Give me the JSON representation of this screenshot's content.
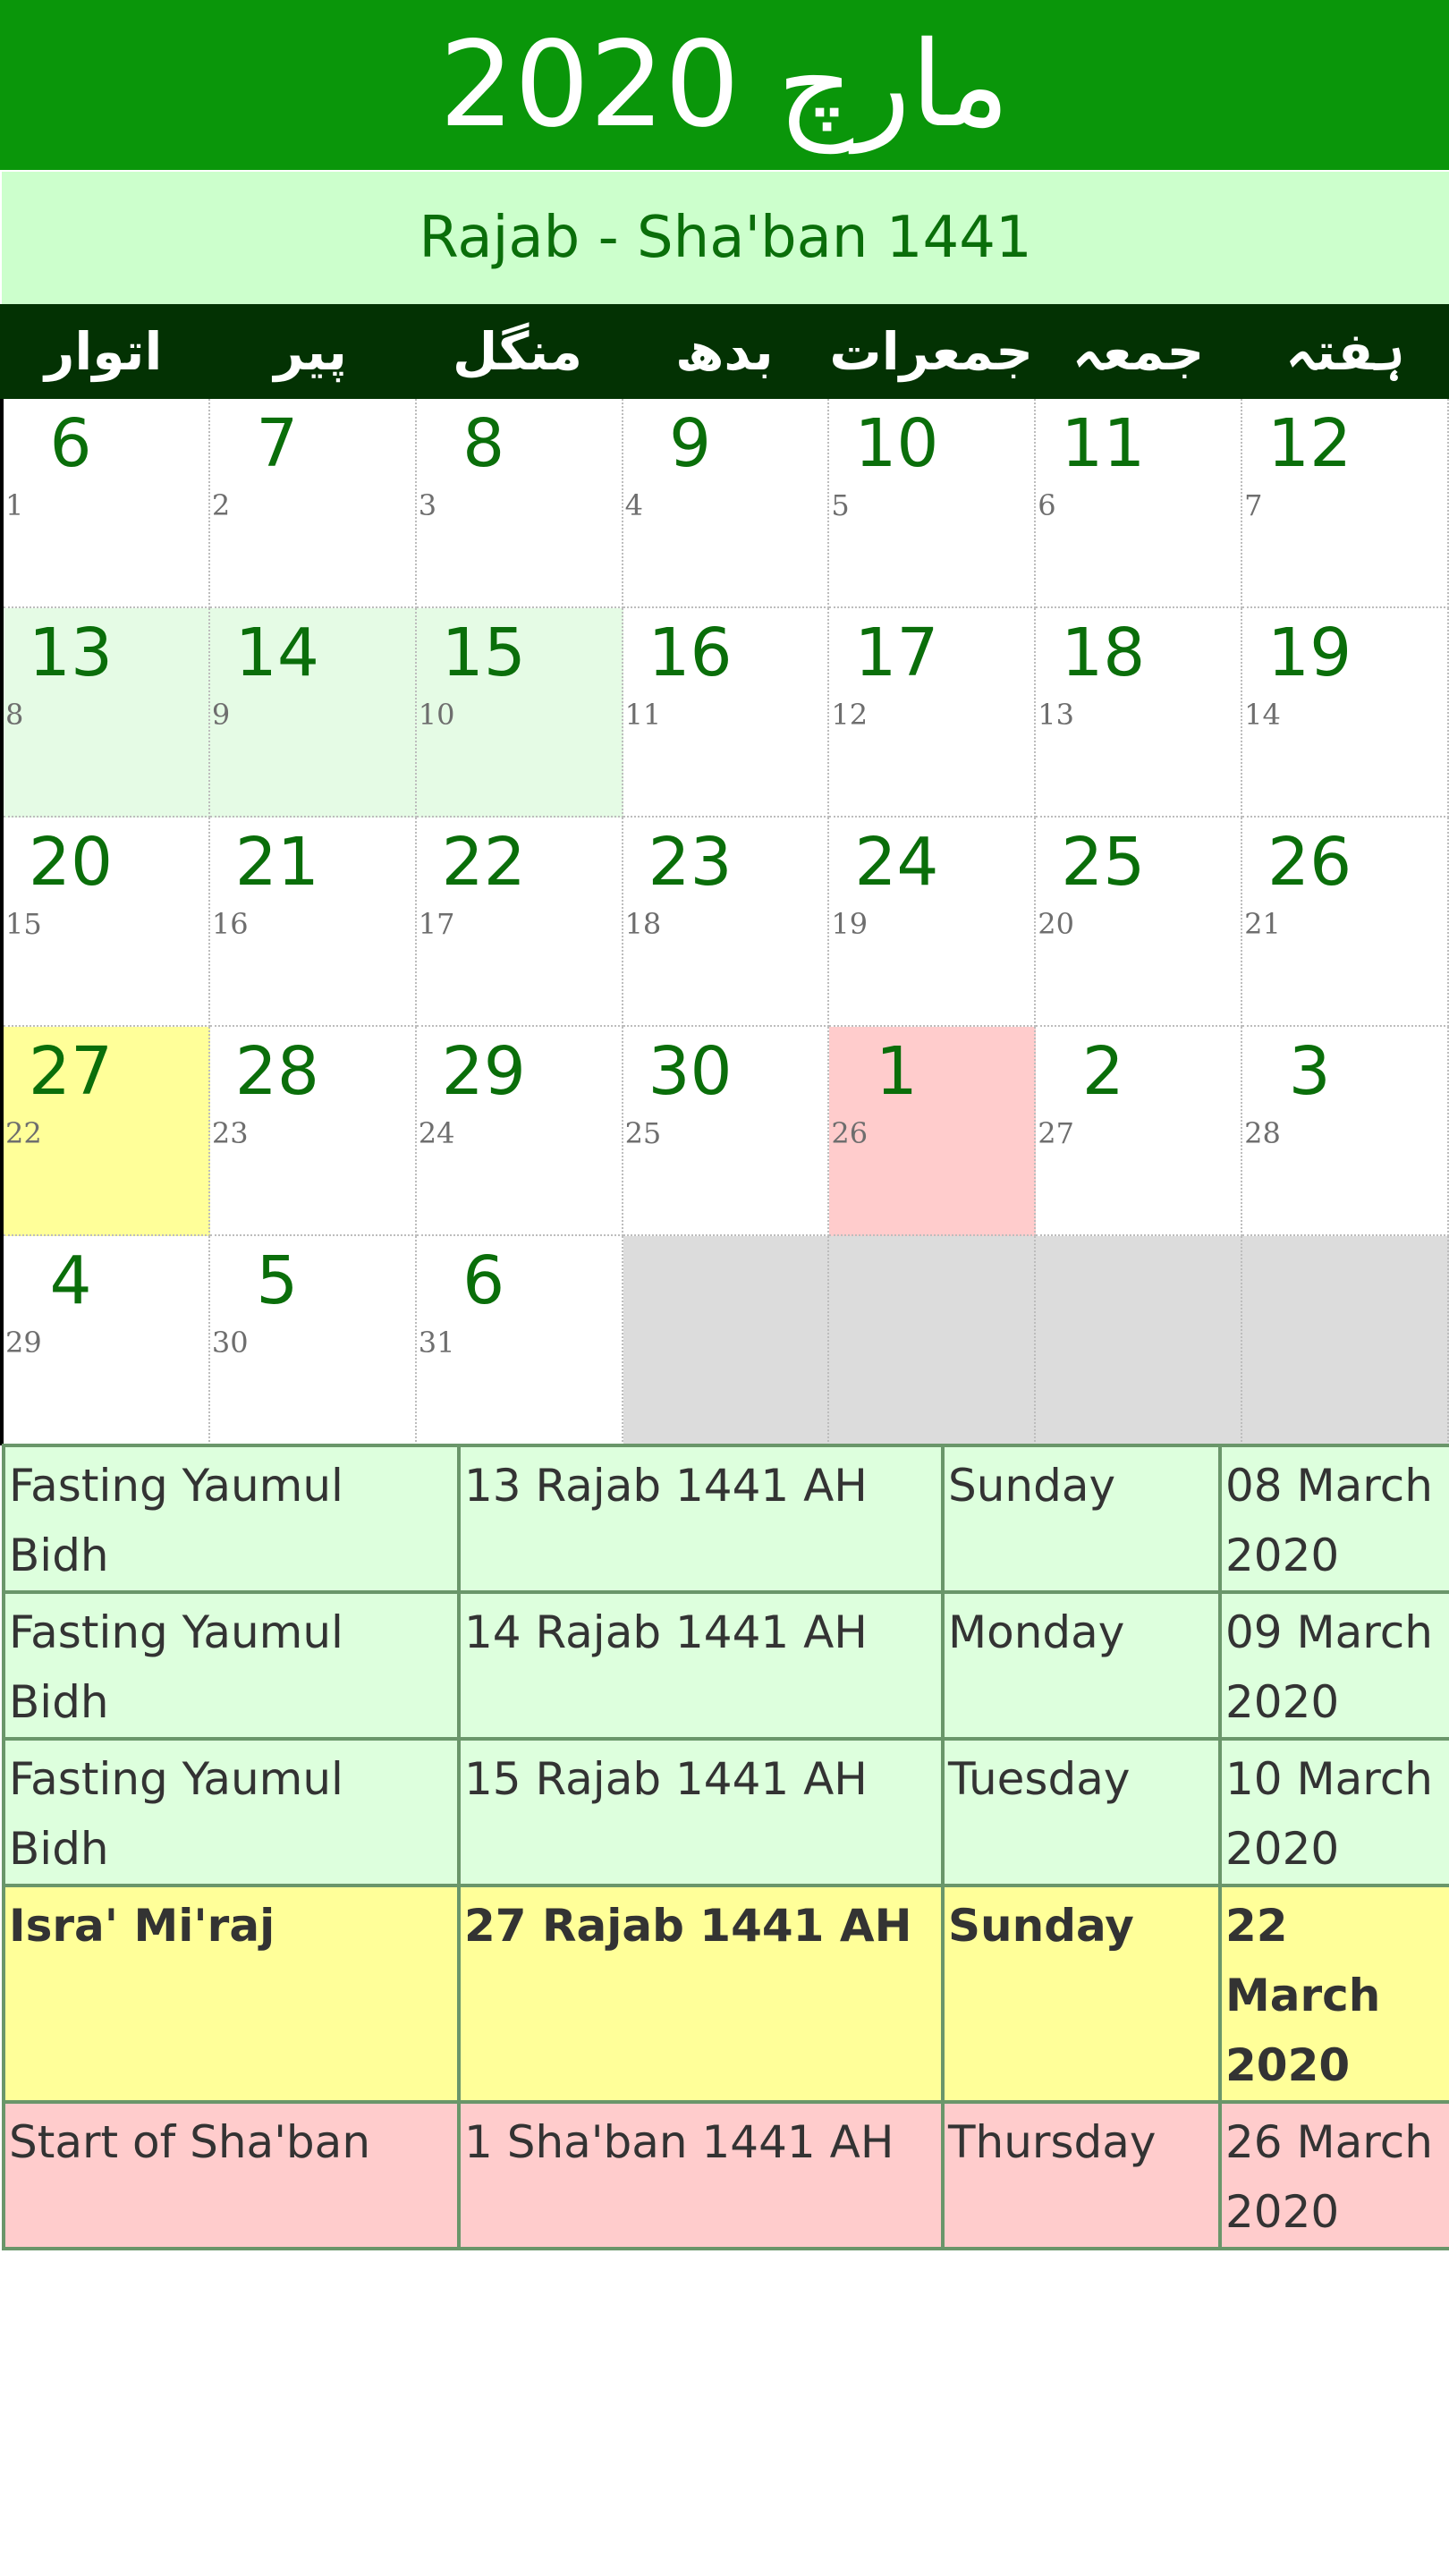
{
  "header": {
    "title": "مارچ 2020",
    "subtitle": "Rajab - Sha'ban 1441"
  },
  "weekdays": [
    "اتوار",
    "پیر",
    "منگل",
    "بدھ",
    "جمعرات",
    "جمعہ",
    "ہفتہ"
  ],
  "calendar": {
    "weeks": [
      [
        {
          "hijri": "6",
          "greg": "1",
          "style": "normal"
        },
        {
          "hijri": "7",
          "greg": "2",
          "style": "normal"
        },
        {
          "hijri": "8",
          "greg": "3",
          "style": "normal"
        },
        {
          "hijri": "9",
          "greg": "4",
          "style": "normal"
        },
        {
          "hijri": "10",
          "greg": "5",
          "style": "normal"
        },
        {
          "hijri": "11",
          "greg": "6",
          "style": "normal"
        },
        {
          "hijri": "12",
          "greg": "7",
          "style": "normal"
        }
      ],
      [
        {
          "hijri": "13",
          "greg": "8",
          "style": "light"
        },
        {
          "hijri": "14",
          "greg": "9",
          "style": "light"
        },
        {
          "hijri": "15",
          "greg": "10",
          "style": "light"
        },
        {
          "hijri": "16",
          "greg": "11",
          "style": "normal"
        },
        {
          "hijri": "17",
          "greg": "12",
          "style": "normal"
        },
        {
          "hijri": "18",
          "greg": "13",
          "style": "normal"
        },
        {
          "hijri": "19",
          "greg": "14",
          "style": "normal"
        }
      ],
      [
        {
          "hijri": "20",
          "greg": "15",
          "style": "normal"
        },
        {
          "hijri": "21",
          "greg": "16",
          "style": "normal"
        },
        {
          "hijri": "22",
          "greg": "17",
          "style": "normal"
        },
        {
          "hijri": "23",
          "greg": "18",
          "style": "normal"
        },
        {
          "hijri": "24",
          "greg": "19",
          "style": "normal"
        },
        {
          "hijri": "25",
          "greg": "20",
          "style": "normal"
        },
        {
          "hijri": "26",
          "greg": "21",
          "style": "normal"
        }
      ],
      [
        {
          "hijri": "27",
          "greg": "22",
          "style": "today"
        },
        {
          "hijri": "28",
          "greg": "23",
          "style": "normal"
        },
        {
          "hijri": "29",
          "greg": "24",
          "style": "normal"
        },
        {
          "hijri": "30",
          "greg": "25",
          "style": "normal"
        },
        {
          "hijri": "1",
          "greg": "26",
          "style": "pink"
        },
        {
          "hijri": "2",
          "greg": "27",
          "style": "normal"
        },
        {
          "hijri": "3",
          "greg": "28",
          "style": "normal"
        }
      ],
      [
        {
          "hijri": "4",
          "greg": "29",
          "style": "normal"
        },
        {
          "hijri": "5",
          "greg": "30",
          "style": "normal"
        },
        {
          "hijri": "6",
          "greg": "31",
          "style": "normal"
        },
        {
          "hijri": "",
          "greg": "",
          "style": "empty"
        },
        {
          "hijri": "",
          "greg": "",
          "style": "empty"
        },
        {
          "hijri": "",
          "greg": "",
          "style": "empty"
        },
        {
          "hijri": "",
          "greg": "",
          "style": "empty"
        }
      ]
    ]
  },
  "events": [
    {
      "name": "Fasting Yaumul Bidh",
      "hijri_date": "13 Rajab 1441 AH",
      "weekday": "Sunday",
      "greg_date": "08 March 2020",
      "style": "green"
    },
    {
      "name": "Fasting Yaumul Bidh",
      "hijri_date": "14 Rajab 1441 AH",
      "weekday": "Monday",
      "greg_date": "09 March 2020",
      "style": "green"
    },
    {
      "name": "Fasting Yaumul Bidh",
      "hijri_date": "15 Rajab 1441 AH",
      "weekday": "Tuesday",
      "greg_date": "10 March 2020",
      "style": "green"
    },
    {
      "name": "Isra' Mi'raj",
      "hijri_date": "27 Rajab 1441 AH",
      "weekday": "Sunday",
      "greg_date": "22 March 2020",
      "style": "yellow"
    },
    {
      "name": "Start of Sha'ban",
      "hijri_date": "1 Sha'ban 1441 AH",
      "weekday": "Thursday",
      "greg_date": "26 March 2020",
      "style": "pink"
    }
  ],
  "colors": {
    "header_bg": "#0a960a",
    "subtitle_bg": "#ccffcc",
    "weekday_bg": "#033203",
    "day_number": "#0a6e0a",
    "highlight_light": "#e5fbe5",
    "highlight_today": "#ffff99",
    "highlight_event": "#ffcccc",
    "empty_cell": "#dcdcdc"
  }
}
